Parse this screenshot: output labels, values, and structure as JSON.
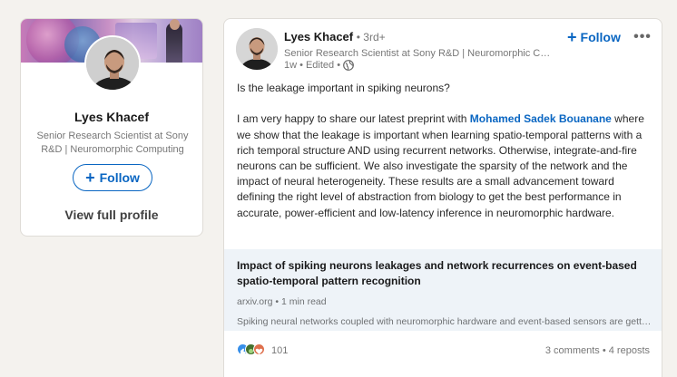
{
  "profile_card": {
    "name": "Lyes Khacef",
    "headline": "Senior Research Scientist at Sony R&D | Neuromorphic Computing",
    "follow_label": "Follow",
    "view_profile_label": "View full profile"
  },
  "post": {
    "author": {
      "name": "Lyes Khacef",
      "degree": "• 3rd+",
      "headline": "Senior Research Scientist at Sony R&D | Neuromorphic Computing",
      "time": "1w",
      "edited": "• Edited •"
    },
    "follow_label": "Follow",
    "more_label": "•••",
    "text": {
      "question": "Is the leakage important in spiking neurons?",
      "intro": "I am very happy to share our latest preprint with ",
      "mention": "Mohamed Sadek Bouanane",
      "body": " where we show that the leakage is important when learning spatio-temporal patterns with a rich temporal structure AND using recurrent networks. Otherwise, integrate-and-fire neurons can be sufficient. We also investigate the sparsity of the network and the impact of neural heterogeneity. These results are a small advancement toward defining the right level of abstraction from biology to get the best performance in accurate, power-efficient and low-latency inference in neuromorphic hardware."
    },
    "article": {
      "title": "Impact of spiking neurons leakages and network recurrences on event-based spatio-temporal pattern recognition",
      "source": "arxiv.org • 1 min read",
      "description": "Spiking neural networks coupled with neuromorphic hardware and event-based sensors are getting increased interest for low-latency and low-power inference at the edge."
    },
    "social": {
      "reaction_count": "101",
      "comments_reposts": "3 comments • 4 reposts",
      "reaction_icons": [
        "like-icon",
        "celebrate-icon",
        "love-icon"
      ]
    }
  },
  "colors": {
    "accent": "#0a66c2",
    "background": "#f4f2ee",
    "article_bg": "#eef3f8"
  }
}
